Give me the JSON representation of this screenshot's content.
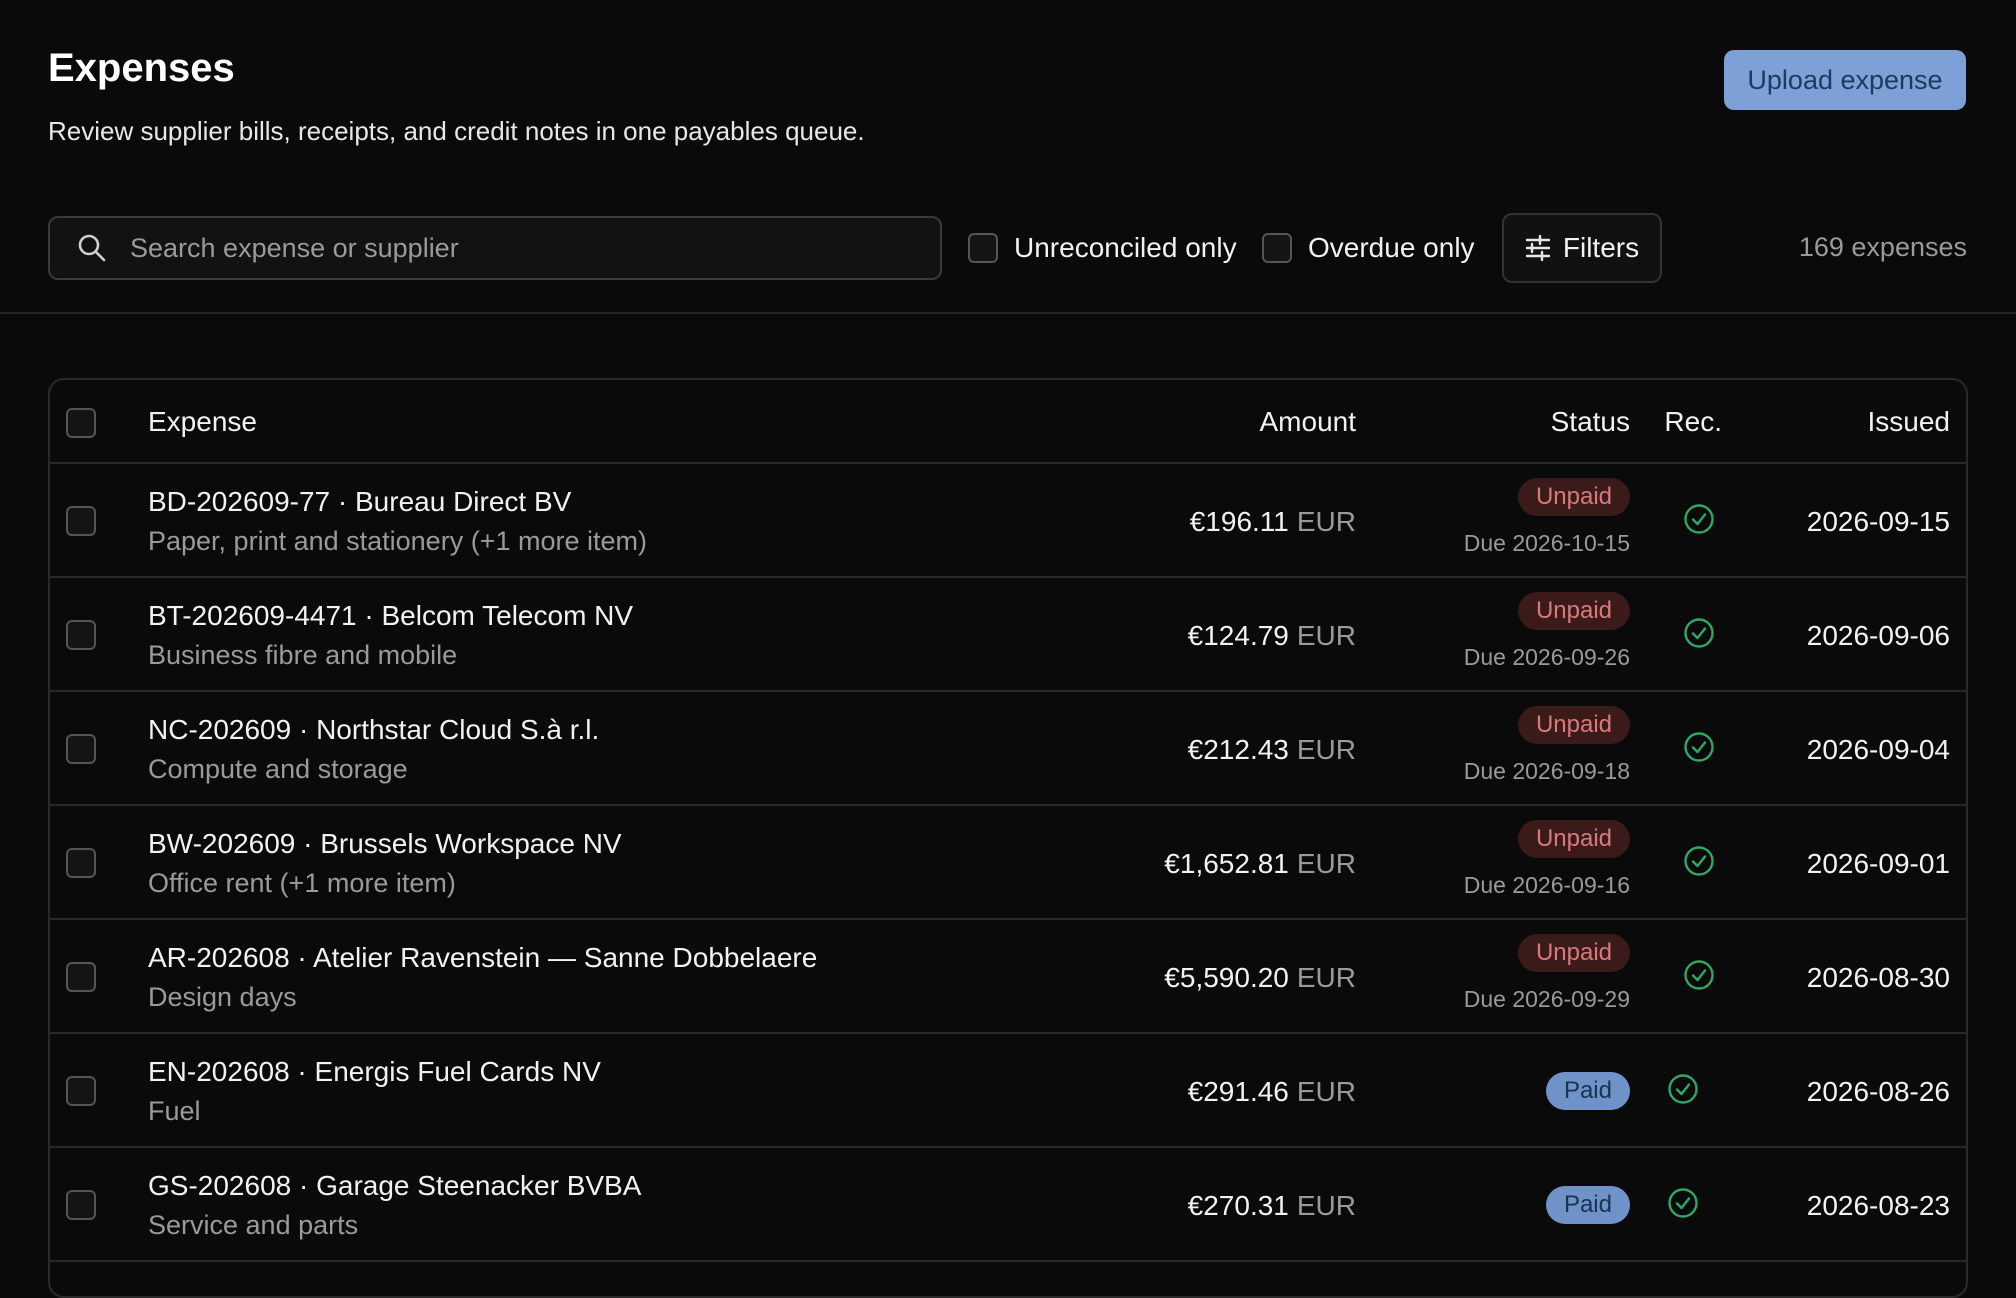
{
  "header": {
    "title": "Expenses",
    "subtitle": "Review supplier bills, receipts, and credit notes in one payables queue.",
    "upload_label": "Upload expense"
  },
  "toolbar": {
    "search_placeholder": "Search expense or supplier",
    "unreconciled_label": "Unreconciled only",
    "overdue_label": "Overdue only",
    "filters_label": "Filters",
    "count_label": "169 expenses"
  },
  "table": {
    "columns": {
      "expense": "Expense",
      "amount": "Amount",
      "status": "Status",
      "rec": "Rec.",
      "issued": "Issued"
    },
    "rows": [
      {
        "title": "BD-202609-77 · Bureau Direct BV",
        "description": "Paper, print and stationery (+1 more item)",
        "amount": "€196.11",
        "currency": "EUR",
        "status": "Unpaid",
        "due": "Due 2026-10-15",
        "reconciled": true,
        "issued": "2026-09-15"
      },
      {
        "title": "BT-202609-4471 · Belcom Telecom NV",
        "description": "Business fibre and mobile",
        "amount": "€124.79",
        "currency": "EUR",
        "status": "Unpaid",
        "due": "Due 2026-09-26",
        "reconciled": true,
        "issued": "2026-09-06"
      },
      {
        "title": "NC-202609 · Northstar Cloud S.à r.l.",
        "description": "Compute and storage",
        "amount": "€212.43",
        "currency": "EUR",
        "status": "Unpaid",
        "due": "Due 2026-09-18",
        "reconciled": true,
        "issued": "2026-09-04"
      },
      {
        "title": "BW-202609 · Brussels Workspace NV",
        "description": "Office rent (+1 more item)",
        "amount": "€1,652.81",
        "currency": "EUR",
        "status": "Unpaid",
        "due": "Due 2026-09-16",
        "reconciled": true,
        "issued": "2026-09-01"
      },
      {
        "title": "AR-202608 · Atelier Ravenstein — Sanne Dobbelaere",
        "description": "Design days",
        "amount": "€5,590.20",
        "currency": "EUR",
        "status": "Unpaid",
        "due": "Due 2026-09-29",
        "reconciled": true,
        "issued": "2026-08-30"
      },
      {
        "title": "EN-202608 · Energis Fuel Cards NV",
        "description": "Fuel",
        "amount": "€291.46",
        "currency": "EUR",
        "status": "Paid",
        "due": "",
        "reconciled": true,
        "issued": "2026-08-26"
      },
      {
        "title": "GS-202608 · Garage Steenacker BVBA",
        "description": "Service and parts",
        "amount": "€270.31",
        "currency": "EUR",
        "status": "Paid",
        "due": "",
        "reconciled": true,
        "issued": "2026-08-23"
      }
    ]
  },
  "colors": {
    "background": "#0a0a0a",
    "accent": "#7da0d6",
    "unpaid": "#d87a7a",
    "paid": "#6f93c8",
    "reconciled": "#2fa865"
  }
}
